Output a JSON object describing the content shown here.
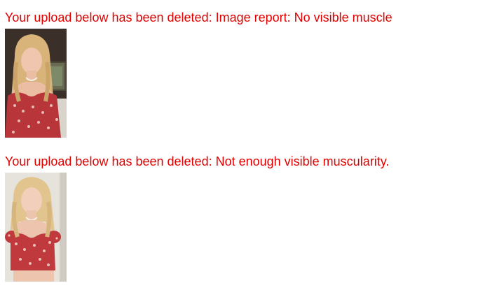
{
  "notices": [
    {
      "message": "Your upload below has been deleted: Image report: No visible muscle",
      "thumbnail_alt": "Deleted upload photo"
    },
    {
      "message": "Your upload below has been deleted: Not enough visible muscularity.",
      "thumbnail_alt": "Deleted upload photo"
    }
  ],
  "colors": {
    "message_text": "#e00000",
    "background": "#ffffff"
  }
}
